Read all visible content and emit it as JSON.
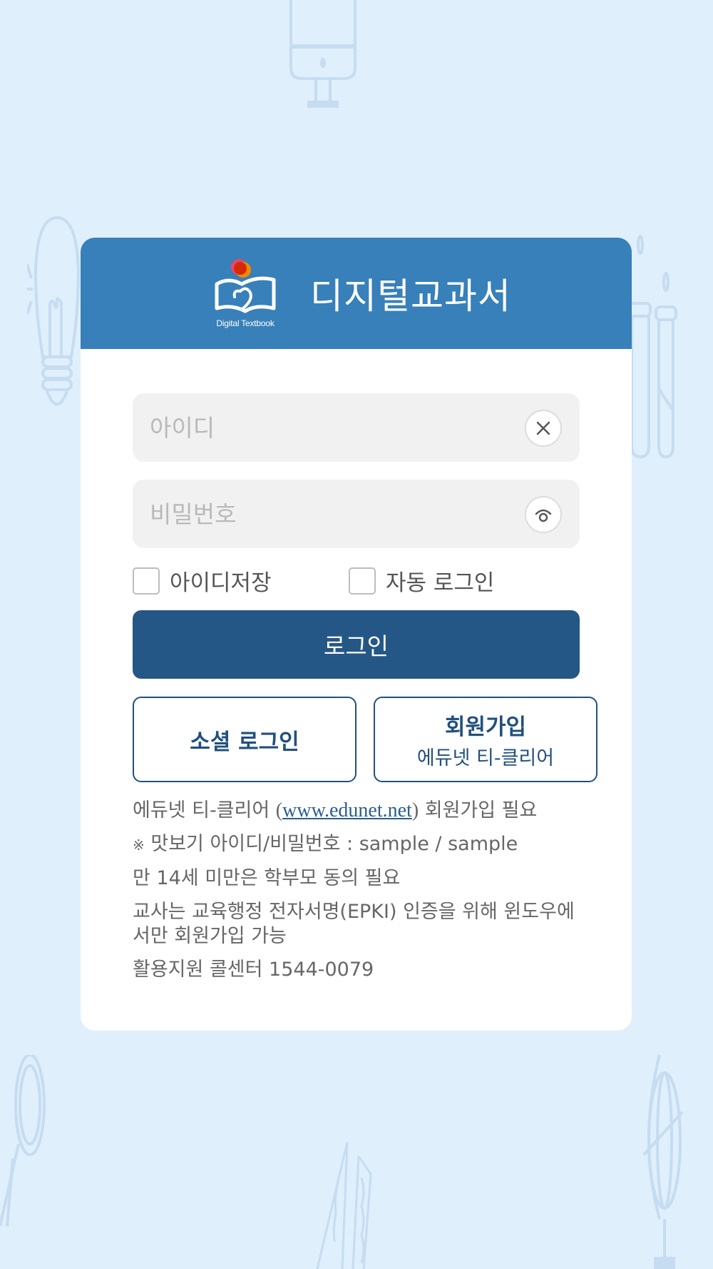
{
  "header": {
    "logo_caption": "Digital Textbook",
    "title": "디지털교과서"
  },
  "login_form": {
    "id_field": {
      "value": "",
      "placeholder": "아이디",
      "action_icon": "clear-icon"
    },
    "password_field": {
      "value": "",
      "placeholder": "비밀번호",
      "action_icon": "show-password-icon"
    },
    "remember_id": {
      "label": "아이디저장",
      "checked": false
    },
    "auto_login": {
      "label": "자동 로그인",
      "checked": false
    },
    "login_button": "로그인"
  },
  "secondary_buttons": {
    "social_login": "소셜 로그인",
    "signup_main": "회원가입",
    "signup_sub": "에듀넷 티-클리어"
  },
  "info": {
    "line1_prefix": "에듀넷 티-클리어 ",
    "line1_paren_open": "(",
    "line1_link": "www.edunet.net",
    "line1_paren_close": ")",
    "line1_suffix": " 회원가입 필요",
    "line2_mark": "※",
    "line2_text": " 맛보기 아이디/비밀번호 : sample / sample",
    "line3": "만 14세 미만은 학부모 동의 필요",
    "line4": "교사는 교육행정 전자서명(EPKI) 인증을 위해 윈도우에서만 회원가입 가능",
    "line5": "활용지원 콜센터  1544-0079"
  },
  "colors": {
    "background": "#dfeffc",
    "header": "#3880b9",
    "primary_button": "#255786",
    "outline": "#22507e",
    "link": "#2a5e8e"
  }
}
